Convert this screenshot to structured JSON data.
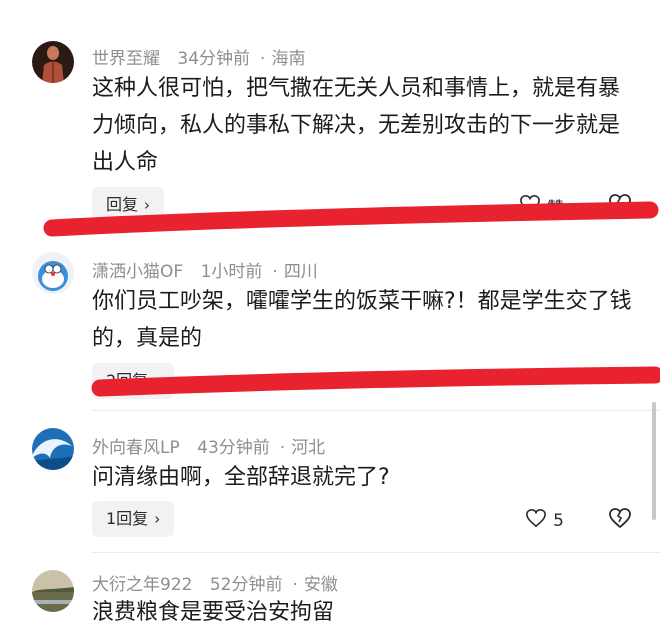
{
  "comments": [
    {
      "username": "世界至耀",
      "time": "34分钟前",
      "location": "海南",
      "text": "这种人很可怕，把气撒在无关人员和事情上，就是有暴力倾向，私人的事私下解决，无差别攻击的下一步就是出人命",
      "reply": "回复",
      "like": "赞",
      "avatar": "anatomy-figure"
    },
    {
      "username": "潇洒小猫OF",
      "time": "1小时前",
      "location": "四川",
      "text": "你们员工吵架，嚯嚯学生的饭菜干嘛?！都是学生交了钱的，真是的",
      "reply": "2回复",
      "avatar": "doraemon"
    },
    {
      "username": "外向春风LP",
      "time": "43分钟前",
      "location": "河北",
      "text": "问清缘由啊，全部辞退就完了?",
      "reply": "1回复",
      "like": "5",
      "avatar": "wave"
    },
    {
      "username": "大衍之年922",
      "time": "52分钟前",
      "location": "安徽",
      "text": "浪费粮食是要受治安拘留",
      "avatar": "landscape"
    }
  ],
  "colors": {
    "accent_line": "#e8232f",
    "meta": "#8e8e93",
    "text": "#1c1c1e"
  },
  "icons": {
    "like": "heart-outline-icon",
    "dislike": "broken-heart-icon",
    "chevron": "chevron-right-icon"
  }
}
